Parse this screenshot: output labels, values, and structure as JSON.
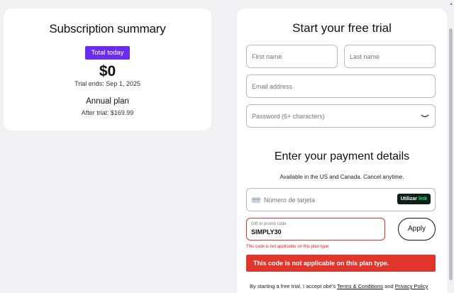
{
  "summary": {
    "title": "Subscription summary",
    "badge": "Total today",
    "price": "$0",
    "trial_ends": "Trial ends: Sep 1, 2025",
    "plan": "Annual plan",
    "after_trial": "After trial: $169.99"
  },
  "trial": {
    "title": "Start your free trial",
    "first_name_placeholder": "First name",
    "last_name_placeholder": "Last name",
    "email_placeholder": "Email address",
    "password_placeholder": "Password (6+ characters)"
  },
  "payment": {
    "title": "Enter your payment details",
    "availability": "Available in the US and Canada. Cancel anytime.",
    "card_placeholder": "Número de tarjeta",
    "link_button_prefix": "Utilizar",
    "link_button_brand": "link",
    "promo_label": "Gift or promo code",
    "promo_value": "SIMPLY30",
    "apply_label": "Apply",
    "error_small": "This code is not applicable on this plan type.",
    "error_banner": "This code is not applicable on this plan type."
  },
  "terms": {
    "prefix": "By starting a free trial, I accept obé's",
    "terms_link": "Terms & Conditions",
    "and": "and",
    "privacy_link": "Privacy Policy"
  },
  "colors": {
    "accent": "#6a2cf0",
    "error": "#e0352b",
    "link_green": "#2ee07a"
  }
}
